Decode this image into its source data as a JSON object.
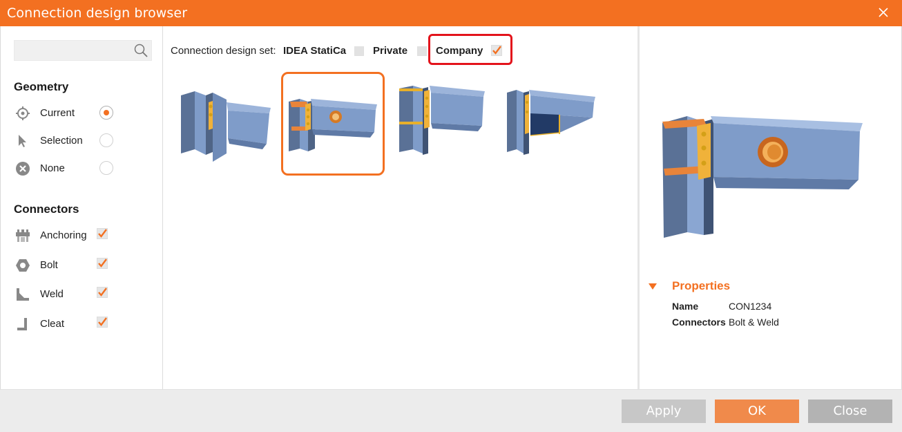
{
  "window": {
    "title": "Connection design browser"
  },
  "search": {
    "value": "",
    "placeholder": ""
  },
  "geometry": {
    "title": "Geometry",
    "items": [
      {
        "label": "Current",
        "icon": "crosshair-icon",
        "selected": true
      },
      {
        "label": "Selection",
        "icon": "cursor-arrow-icon",
        "selected": false
      },
      {
        "label": "None",
        "icon": "x-circle-icon",
        "selected": false
      }
    ]
  },
  "connectors": {
    "title": "Connectors",
    "items": [
      {
        "label": "Anchoring",
        "icon": "anchoring-icon",
        "checked": true
      },
      {
        "label": "Bolt",
        "icon": "bolt-nut-icon",
        "checked": true
      },
      {
        "label": "Weld",
        "icon": "weld-icon",
        "checked": true
      },
      {
        "label": "Cleat",
        "icon": "cleat-icon",
        "checked": true
      }
    ]
  },
  "design_set": {
    "label": "Connection design set:",
    "options": [
      {
        "label": "IDEA StatiCa",
        "checked": false
      },
      {
        "label": "Private",
        "checked": false
      },
      {
        "label": "Company",
        "checked": true
      }
    ]
  },
  "thumbnails": [
    {
      "name": "bolted-end-plate-connection",
      "selected": false
    },
    {
      "name": "end-plate-with-opening",
      "selected": true
    },
    {
      "name": "stiffened-end-plate-connection",
      "selected": false
    },
    {
      "name": "haunch-connection",
      "selected": false
    }
  ],
  "properties": {
    "title": "Properties",
    "rows": [
      {
        "key": "Name",
        "value": "CON1234"
      },
      {
        "key": "Connectors",
        "value": "Bolt & Weld"
      }
    ]
  },
  "footer": {
    "apply": "Apply",
    "ok": "OK",
    "close": "Close"
  },
  "colors": {
    "accent": "#f37021",
    "highlight": "#e3131b",
    "steel": "#7f9cc9"
  }
}
